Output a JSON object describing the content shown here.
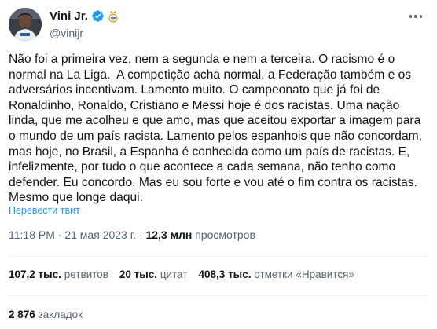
{
  "author": {
    "display_name": "Vini Jr.",
    "handle": "@vinijr"
  },
  "tweet": {
    "text": "Não foi a primeira vez, nem a segunda e nem a terceira. O racismo é o normal na La Liga.  A competição acha normal, a Federação também e os adversários incentivam. Lamento muito. O campeonato que já foi de Ronaldinho, Ronaldo, Cristiano e Messi hoje é dos racistas. Uma nação linda, que me acolheu e que amo, mas que aceitou exportar a imagem para o mundo de um país racista. Lamento pelos espanhois que não concordam, mas hoje, no Brasil, a Espanha é conhecida como um país de racistas. E, infelizmente, por tudo o que acontece a cada semana, não tenho como defender. Eu concordo. Mas eu sou forte e vou até o fim contra os racistas. Mesmo que longe daqui.",
    "translate_label": "Перевести твит",
    "time": "11:18 PM",
    "date": "21 мая 2023 г.",
    "views_count": "12,3 млн",
    "views_label": "просмотров"
  },
  "stats": {
    "retweets_count": "107,2 тыс.",
    "retweets_label": "ретвитов",
    "quotes_count": "20 тыс.",
    "quotes_label": "цитат",
    "likes_count": "408,3 тыс.",
    "likes_label": "отметки «Нравится»",
    "bookmarks_count": "2 876",
    "bookmarks_label": "закладок"
  },
  "colors": {
    "link": "#1d9bf0",
    "secondary_text": "#536471",
    "primary_text": "#0f1419",
    "divider": "#eff3f4"
  },
  "icons": [
    "avatar",
    "verified-badge-icon",
    "club-crest-icon",
    "more-options-icon"
  ]
}
